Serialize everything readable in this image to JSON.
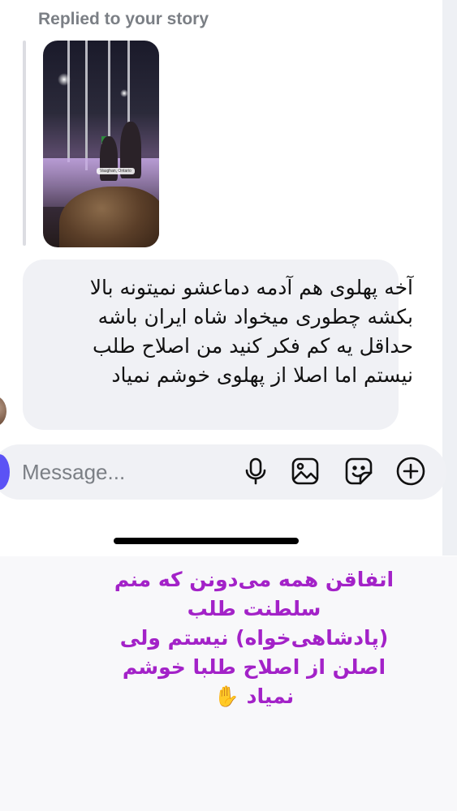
{
  "story_reply": {
    "label": "Replied to your story",
    "location_tag": "Vaughan, Ontario"
  },
  "message": {
    "text": "آخه پهلوی هم آدمه دماعشو نمیتونه بالا بکشه چطوری میخواد شاه ایران باشه حداقل یه کم فکر کنید من اصلاح طلب نیستم اما اصلا از پهلوی خوشم نمیاد"
  },
  "composer": {
    "placeholder": "Message..."
  },
  "icons": {
    "mic": "microphone-icon",
    "gallery": "image-gallery-icon",
    "sticker": "sticker-icon",
    "add": "plus-circle-icon"
  },
  "caption": {
    "text": "اتفاقن همه می‌دونن که منم سلطنت طلب (پادشاهی‌خواه) نیستم ولی اصلن از اصلاح طلبا خوشم نمیاد ✋"
  },
  "colors": {
    "bubble": "#f0f1f5",
    "caption": "#a322c8",
    "accent": "#5b52f5"
  }
}
